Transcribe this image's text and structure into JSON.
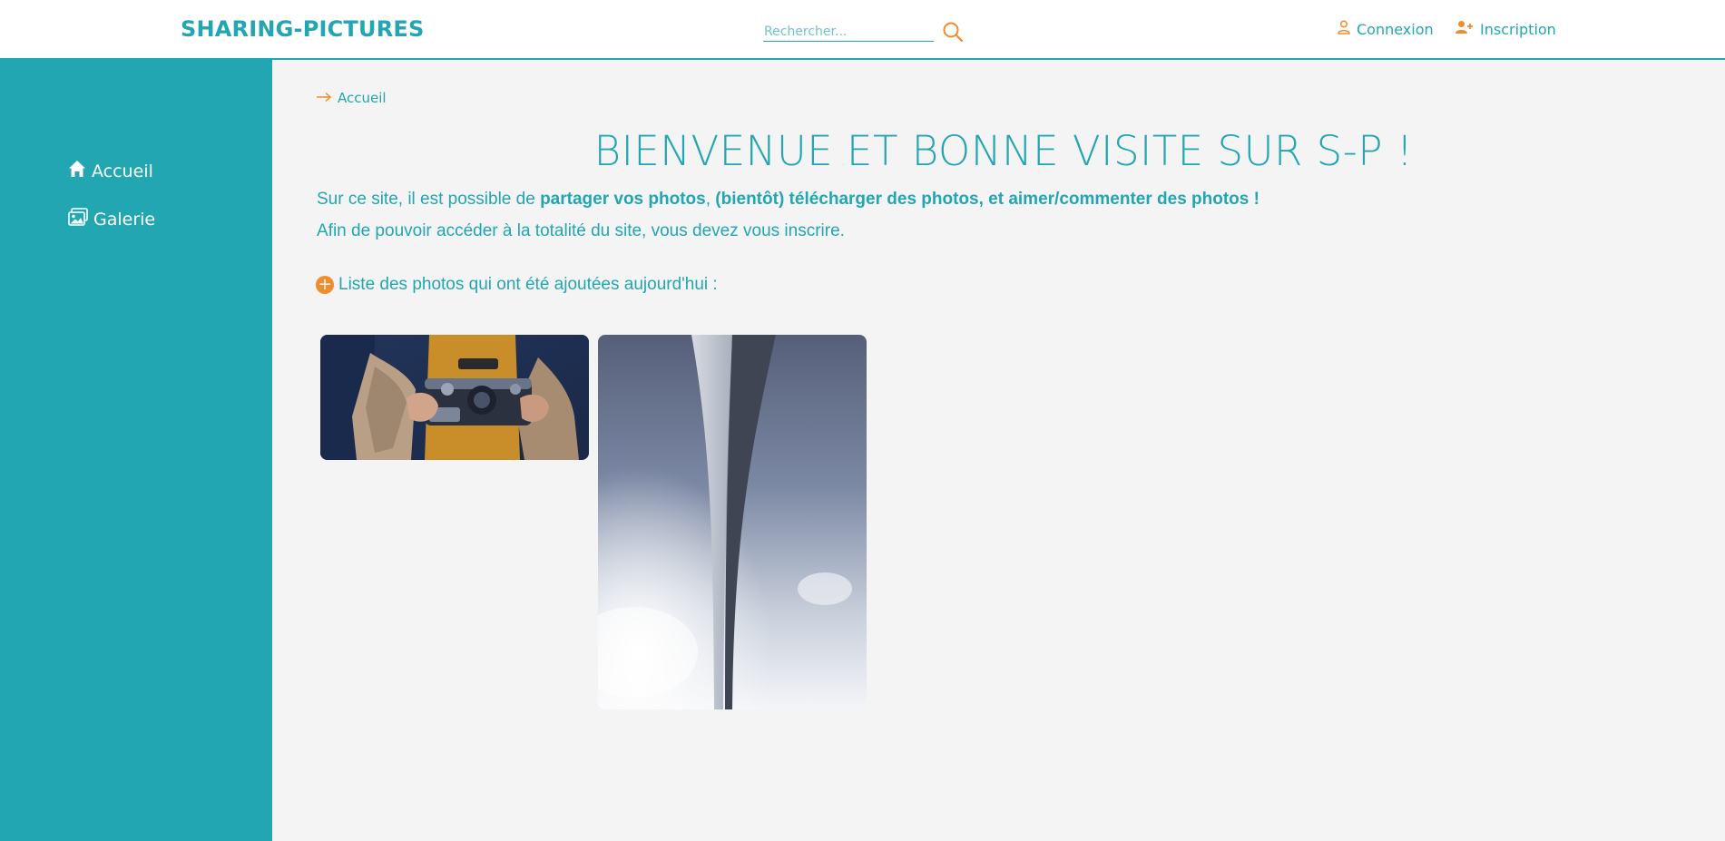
{
  "header": {
    "brand": "SHARING-PICTURES",
    "search_placeholder": "Rechercher...",
    "login_label": "Connexion",
    "signup_label": "Inscription"
  },
  "sidebar": {
    "items": [
      {
        "label": "Accueil",
        "icon": "home-icon"
      },
      {
        "label": "Galerie",
        "icon": "gallery-icon"
      }
    ]
  },
  "breadcrumb": {
    "label": "Accueil"
  },
  "main": {
    "title": "BIENVENUE ET BONNE VISITE SUR S-P !",
    "intro1_pre": "Sur ce site, il est possible de ",
    "intro1_b1": "partager vos photos",
    "intro1_sep": ", ",
    "intro1_b2": "(bientôt) télécharger des photos",
    "intro1_b3": ", et aimer/commenter des photos !",
    "intro2": "Afin de pouvoir accéder à la totalité du site, vous devez vous inscrire.",
    "list_heading": "Liste des photos qui ont été ajoutées aujourd'hui :",
    "photos": [
      {
        "subject": "camera-in-hands-photo"
      },
      {
        "subject": "tall-tower-sky-photo"
      }
    ]
  },
  "colors": {
    "accent": "#21a6b2",
    "secondary": "#ef8d2d",
    "background": "#f4f4f4"
  }
}
